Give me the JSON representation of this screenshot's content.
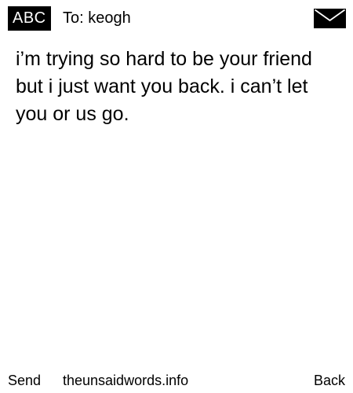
{
  "header": {
    "mode_badge": "ABC",
    "recipient": "To: keogh",
    "icon": "envelope-icon"
  },
  "message": {
    "text": "i’m trying so hard to be your friend but i just want you back. i can’t let you or us go."
  },
  "footer": {
    "send_label": "Send",
    "site_label": "theunsaidwords.info",
    "back_label": "Back"
  },
  "colors": {
    "background": "#ffffff",
    "foreground": "#000000",
    "badge_background": "#000000",
    "badge_text": "#ffffff"
  }
}
